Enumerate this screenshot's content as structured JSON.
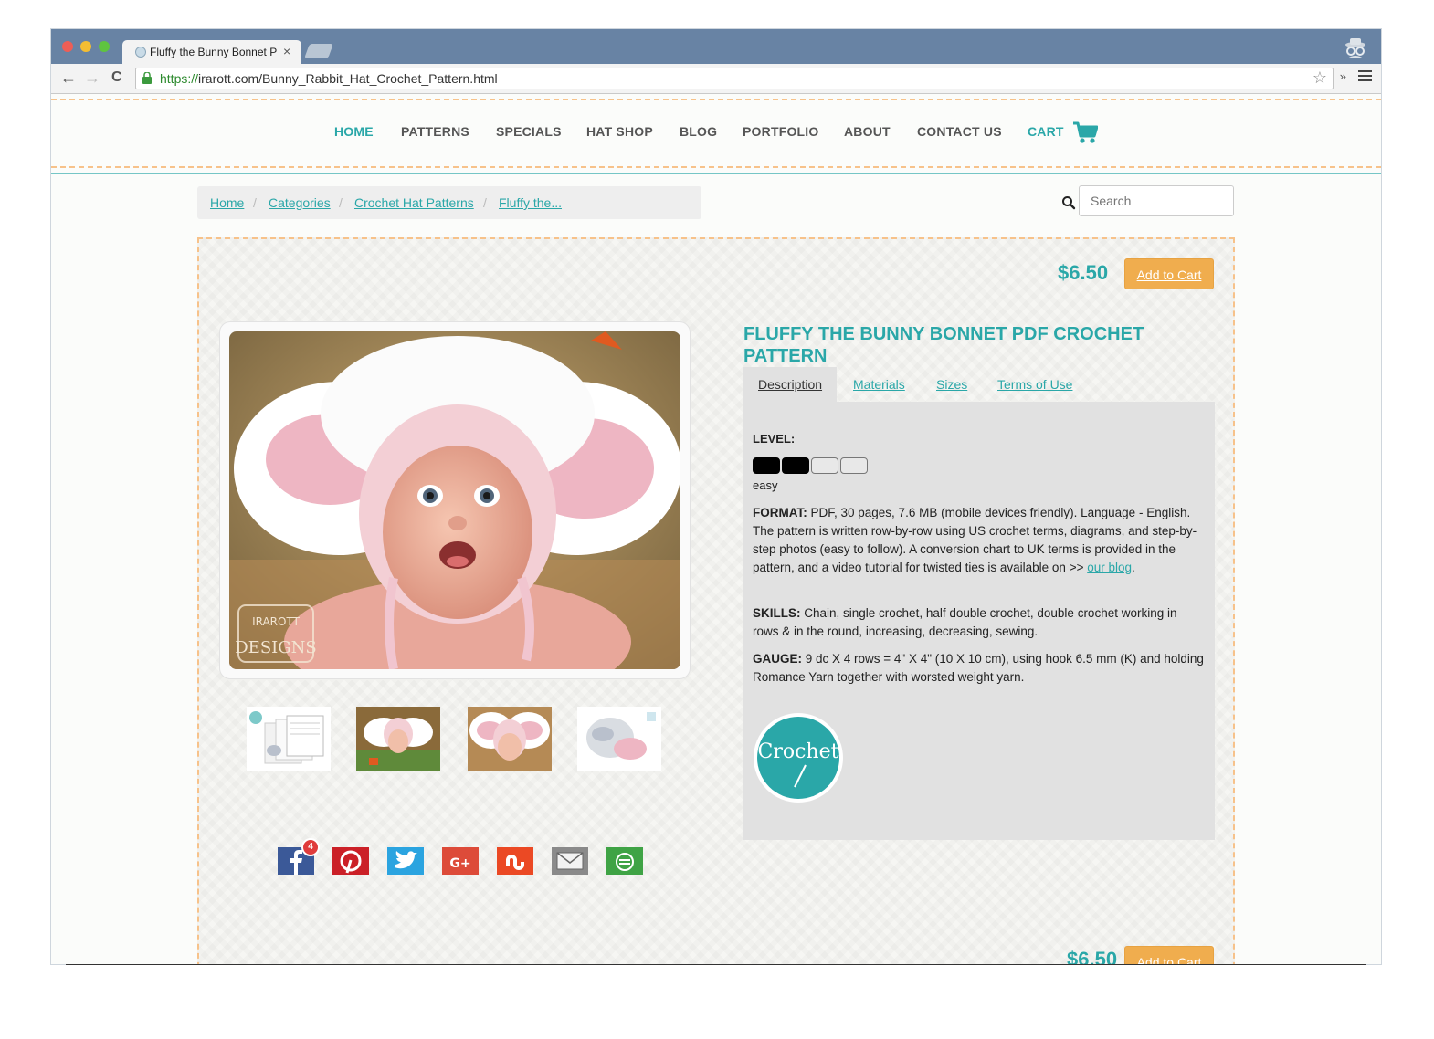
{
  "browser": {
    "tab_title": "Fluffy the Bunny Bonnet PDF Crochet",
    "tab_close": "×",
    "url_scheme": "https://",
    "url_rest": "irarott.com/Bunny_Rabbit_Hat_Crochet_Pattern.html",
    "back": "←",
    "forward": "→",
    "reload": "C",
    "star": "☆",
    "extensions": "»"
  },
  "nav": {
    "items": [
      {
        "label": "HOME"
      },
      {
        "label": "PATTERNS"
      },
      {
        "label": "SPECIALS"
      },
      {
        "label": "HAT SHOP"
      },
      {
        "label": "BLOG"
      },
      {
        "label": "PORTFOLIO"
      },
      {
        "label": "ABOUT"
      },
      {
        "label": "CONTACT US"
      },
      {
        "label": "CART"
      }
    ]
  },
  "breadcrumb": {
    "items": [
      "Home",
      "Categories",
      "Crochet Hat Patterns",
      "Fluffy the..."
    ],
    "separator": "/"
  },
  "search": {
    "placeholder": "Search"
  },
  "product": {
    "price": "$6.50",
    "add_to_cart": "Add to Cart",
    "title": "FLUFFY THE BUNNY BONNET PDF CROCHET PATTERN",
    "tabs": [
      "Description",
      "Materials",
      "Sizes",
      "Terms of Use"
    ],
    "level_label": "LEVEL:",
    "level_value": "easy",
    "level_filled": 2,
    "level_total": 4,
    "format_label": "FORMAT:",
    "format_text": " PDF, 30 pages, 7.6 MB (mobile devices friendly). Language - English. The pattern is written row-by-row using US crochet terms, diagrams, and step-by-step photos (easy to follow). A conversion chart to UK terms is provided in the pattern, and a video tutorial for twisted ties is available on >> ",
    "format_link": "our blog",
    "format_end": ".",
    "skills_label": "SKILLS:",
    "skills_text": " Chain, single crochet, half double crochet, double crochet working in rows & in the round, increasing, decreasing, sewing.",
    "gauge_label": "GAUGE:",
    "gauge_text": " 9 dc X 4 rows = 4\" X 4\" (10 X 10 cm), using hook 6.5 mm (K) and holding Romance Yarn together with worsted weight yarn.",
    "crochet_badge": "Crochet",
    "watermark": "DESIGNS",
    "watermark_top": "IRAROTT"
  },
  "share": {
    "facebook_count": "4",
    "buttons": [
      "facebook-icon",
      "pinterest-icon",
      "twitter-icon",
      "google-plus-icon",
      "stumbleupon-icon",
      "email-icon",
      "more-share-icon"
    ]
  },
  "colors": {
    "accent": "#2aa7a8",
    "button": "#f0ad4e",
    "dash": "#f7c28a",
    "chrome": "#6883a4"
  }
}
